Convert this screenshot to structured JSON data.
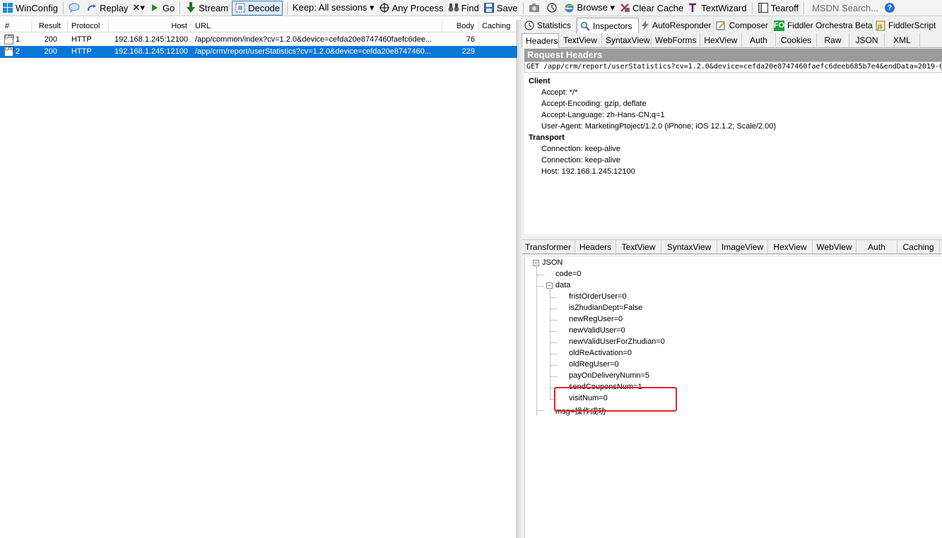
{
  "toolbar": {
    "winconfig": "WinConfig",
    "replay": "Replay",
    "remove": "✕▾",
    "go": "Go",
    "stream": "Stream",
    "decode": "Decode",
    "keep": "Keep: All sessions ▾",
    "any_process": "Any Process",
    "find": "Find",
    "save": "Save",
    "browse": "Browse ▾",
    "clear_cache": "Clear Cache",
    "textwizard": "TextWizard",
    "tearoff": "Tearoff",
    "msdn_search": "MSDN Search...",
    "help": "?"
  },
  "sessions": {
    "columns": {
      "num": "#",
      "result": "Result",
      "protocol": "Protocol",
      "host": "Host",
      "url": "URL",
      "body": "Body",
      "caching": "Caching"
    },
    "rows": [
      {
        "num": "1",
        "result": "200",
        "protocol": "HTTP",
        "host": "192.168.1.245:12100",
        "url": "/app/common/index?cv=1.2.0&device=cefda20e8747460faefc6dee...",
        "body": "76",
        "caching": "",
        "selected": false
      },
      {
        "num": "2",
        "result": "200",
        "protocol": "HTTP",
        "host": "192.168.1.245:12100",
        "url": "/app/crm/report/userStatistics?cv=1.2.0&device=cefda20e8747460...",
        "body": "229",
        "caching": "",
        "selected": true
      }
    ]
  },
  "top_tabs": {
    "statistics": "Statistics",
    "inspectors": "Inspectors",
    "autoresponder": "AutoResponder",
    "composer": "Composer",
    "orchestra": "Fiddler Orchestra Beta",
    "fiddlerscript": "FiddlerScript",
    "fo_badge": "FO"
  },
  "request_tabs": [
    "Headers",
    "TextView",
    "SyntaxView",
    "WebForms",
    "HexView",
    "Auth",
    "Cookies",
    "Raw",
    "JSON",
    "XML"
  ],
  "request": {
    "title": "Request Headers",
    "request_line": "GET /app/crm/report/userStatistics?cv=1.2.0&device=cefda20e8747460faefc6deeb685b7e4&endData=2019-0",
    "client_label": "Client",
    "client": [
      "Accept: */*",
      "Accept-Encoding: gzip, deflate",
      "Accept-Language: zh-Hans-CN;q=1",
      "User-Agent: MarketingPtoject/1.2.0 (iPhone; iOS 12.1.2; Scale/2.00)"
    ],
    "transport_label": "Transport",
    "transport": [
      "Connection: keep-alive",
      "Connection: keep-alive",
      "Host: 192.168.1.245:12100"
    ]
  },
  "response_tabs": [
    "Transformer",
    "Headers",
    "TextView",
    "SyntaxView",
    "ImageView",
    "HexView",
    "WebView",
    "Auth",
    "Caching"
  ],
  "json_tree": {
    "root": "JSON",
    "code": "code=0",
    "data": "data",
    "fields": [
      "fristOrderUser=0",
      "isZhudianDept=False",
      "newRegUser=0",
      "newValidUser=0",
      "newValidUserForZhudian=0",
      "oldReActivation=0",
      "oldRegUser=0",
      "payOnDeliveryNumn=5",
      "sendCouponsNum=1",
      "visitNum=0"
    ],
    "msg": "msg=操作成功",
    "collapse_glyph": "−"
  },
  "colors": {
    "selection": "#0a78d7",
    "highlight_box": "#e0262a",
    "header_bar": "#9b9b9b"
  }
}
